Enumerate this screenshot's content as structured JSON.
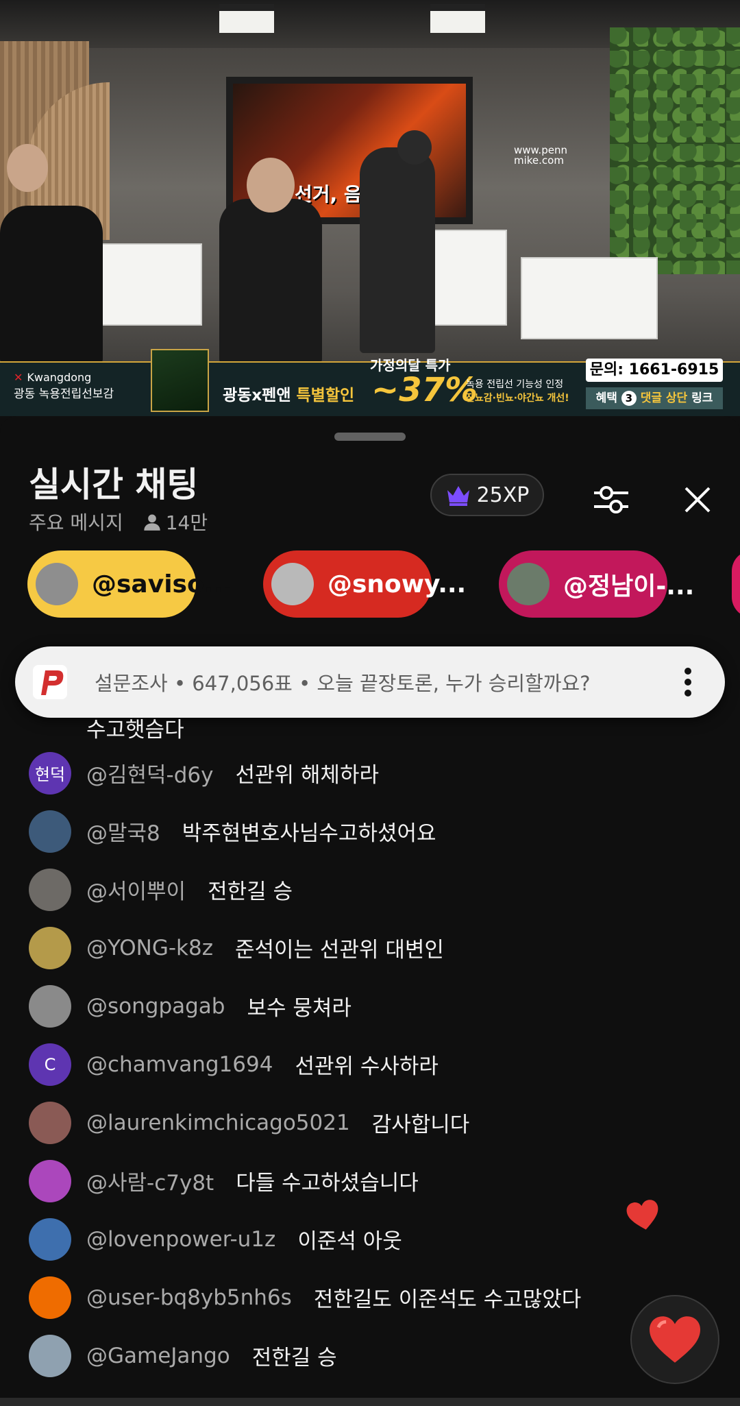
{
  "video": {
    "screen_text": "선거, 음",
    "website": "www.pennmike.com"
  },
  "banner": {
    "brand_en": "Kwangdong",
    "brand_kr": "광동 녹용전립선보감",
    "special": "광동x펜앤",
    "special_highlight": "특별할인",
    "month_label": "가정의달 특가",
    "percent": "~37%",
    "cert_line1": "녹용 전립선 기능성 인정",
    "cert_line2": "잔뇨감·빈뇨·야간뇨 개선!",
    "phone": "문의: 1661-6915",
    "perk_prefix": "혜택",
    "perk_num": "3",
    "perk_highlight": "댓글 상단",
    "perk_suffix": "링크"
  },
  "chat": {
    "title": "실시간 채팅",
    "mode": "주요 메시지",
    "viewers": "14만",
    "xp": "25XP"
  },
  "pills": [
    {
      "label": "@saviso...",
      "bg": "#f6c944",
      "fg": "#0f0f0f",
      "avatar_color": "#8e8e8e"
    },
    {
      "label": "@snowy...",
      "bg": "#d62a21",
      "fg": "#ffffff",
      "avatar_color": "#b9b9b9"
    },
    {
      "label": "@정남이-...",
      "bg": "#c2185b",
      "fg": "#ffffff",
      "avatar_color": "#6b7b6a"
    }
  ],
  "poll": {
    "text": "설문조사 • 647,056표 • 오늘 끝장토론, 누가 승리할까요?"
  },
  "previous_message_tail": "수고햇슴다",
  "messages": [
    {
      "author": "@김현덕-d6y",
      "text": "선관위 해체하라",
      "avatar_text": "현덕",
      "avatar_color": "#5e35b1"
    },
    {
      "author": "@말국8",
      "text": "박주현변호사님수고하셨어요",
      "avatar_text": "",
      "avatar_color": "#3d5a7a"
    },
    {
      "author": "@서이뿌이",
      "text": "전한길 승",
      "avatar_text": "",
      "avatar_color": "#6d6a66"
    },
    {
      "author": "@YONG-k8z",
      "text": "준석이는 선관위 대변인",
      "avatar_text": "",
      "avatar_color": "#b49a4a"
    },
    {
      "author": "@songpagab",
      "text": "보수 뭉쳐라",
      "avatar_text": "",
      "avatar_color": "#8a8a8a"
    },
    {
      "author": "@chamvang1694",
      "text": "선관위 수사하라",
      "avatar_text": "C",
      "avatar_color": "#5e35b1"
    },
    {
      "author": "@laurenkimchicago5021",
      "text": "감사합니다",
      "avatar_text": "",
      "avatar_color": "#8a5a55"
    },
    {
      "author": "@사람-c7y8t",
      "text": "다들 수고하셨습니다",
      "avatar_text": "",
      "avatar_color": "#ab47bc"
    },
    {
      "author": "@lovenpower-u1z",
      "text": "이준석 아웃",
      "avatar_text": "",
      "avatar_color": "#3e6fae"
    },
    {
      "author": "@user-bq8yb5nh6s",
      "text": "전한길도 이준석도 수고많았다",
      "avatar_text": "",
      "avatar_color": "#ef6c00"
    },
    {
      "author": "@GameJango",
      "text": "전한길 승",
      "avatar_text": "",
      "avatar_color": "#8fa1b0"
    }
  ]
}
